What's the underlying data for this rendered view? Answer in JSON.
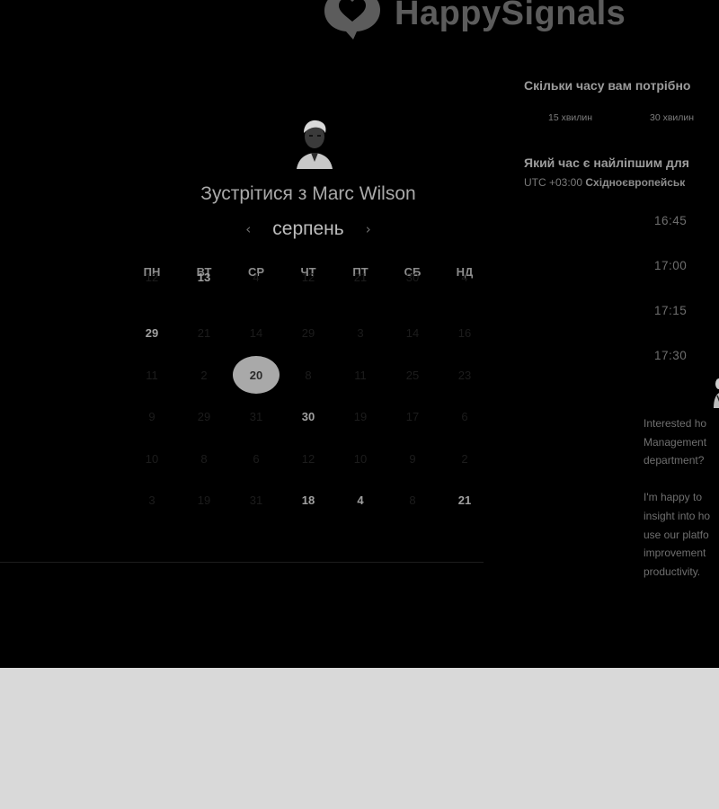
{
  "brand": {
    "name": "HappySignals",
    "logo_icon": "heart-speech-bubble-icon"
  },
  "host": {
    "avatar_icon": "host-avatar-icon"
  },
  "meeting": {
    "title": "Зустрітися з Marc Wilson"
  },
  "calendar": {
    "month": "серпень",
    "prev_icon": "chevron-left-icon",
    "next_icon": "chevron-right-icon",
    "weekdays": [
      "ПН",
      "ВТ",
      "СР",
      "ЧТ",
      "ПТ",
      "СБ",
      "НД"
    ],
    "weeks": [
      [
        {
          "d": "12",
          "s": "off"
        },
        {
          "d": "13",
          "s": "on"
        },
        {
          "d": "4",
          "s": "off"
        },
        {
          "d": "12",
          "s": "off"
        },
        {
          "d": "21",
          "s": "off"
        },
        {
          "d": "30",
          "s": "off"
        },
        {
          "d": "4",
          "s": "off"
        }
      ],
      [
        {
          "d": "29",
          "s": "on"
        },
        {
          "d": "21",
          "s": "off"
        },
        {
          "d": "14",
          "s": "off"
        },
        {
          "d": "29",
          "s": "off"
        },
        {
          "d": "3",
          "s": "off"
        },
        {
          "d": "14",
          "s": "off"
        },
        {
          "d": "16",
          "s": "off"
        }
      ],
      [
        {
          "d": "11",
          "s": "off"
        },
        {
          "d": "2",
          "s": "off"
        },
        {
          "d": "20",
          "s": "selected"
        },
        {
          "d": "8",
          "s": "off"
        },
        {
          "d": "11",
          "s": "off"
        },
        {
          "d": "25",
          "s": "off"
        },
        {
          "d": "23",
          "s": "off"
        }
      ],
      [
        {
          "d": "9",
          "s": "off"
        },
        {
          "d": "29",
          "s": "off"
        },
        {
          "d": "31",
          "s": "off"
        },
        {
          "d": "30",
          "s": "on"
        },
        {
          "d": "19",
          "s": "off"
        },
        {
          "d": "17",
          "s": "off"
        },
        {
          "d": "6",
          "s": "off"
        }
      ],
      [
        {
          "d": "10",
          "s": "off"
        },
        {
          "d": "8",
          "s": "off"
        },
        {
          "d": "6",
          "s": "off"
        },
        {
          "d": "12",
          "s": "off"
        },
        {
          "d": "10",
          "s": "off"
        },
        {
          "d": "9",
          "s": "off"
        },
        {
          "d": "2",
          "s": "off"
        }
      ],
      [
        {
          "d": "3",
          "s": "off"
        },
        {
          "d": "19",
          "s": "off"
        },
        {
          "d": "31",
          "s": "off"
        },
        {
          "d": "18",
          "s": "on"
        },
        {
          "d": "4",
          "s": "on"
        },
        {
          "d": "8",
          "s": "off"
        },
        {
          "d": "21",
          "s": "on"
        }
      ]
    ]
  },
  "duration": {
    "question": "Скільки часу вам потрібно",
    "options": [
      "15 хвилин",
      "30 хвилин"
    ]
  },
  "timepick": {
    "question": "Який час є найліпшим для",
    "timezone_offset": "UTC +03:00",
    "timezone_name": "Східноєвропейськ",
    "slots": [
      "16:45",
      "17:00",
      "17:15",
      "17:30"
    ]
  },
  "intro": {
    "paragraph1": [
      "Interested ho",
      "Management",
      "department?"
    ],
    "paragraph2": [
      "I'm happy to",
      "insight into ho",
      "use our platfo",
      "improvement",
      "productivity."
    ]
  },
  "colors": {
    "page_bg": "#000000",
    "below_bg": "#d9d9d9",
    "selected_day_bg": "#a9a9a9"
  }
}
